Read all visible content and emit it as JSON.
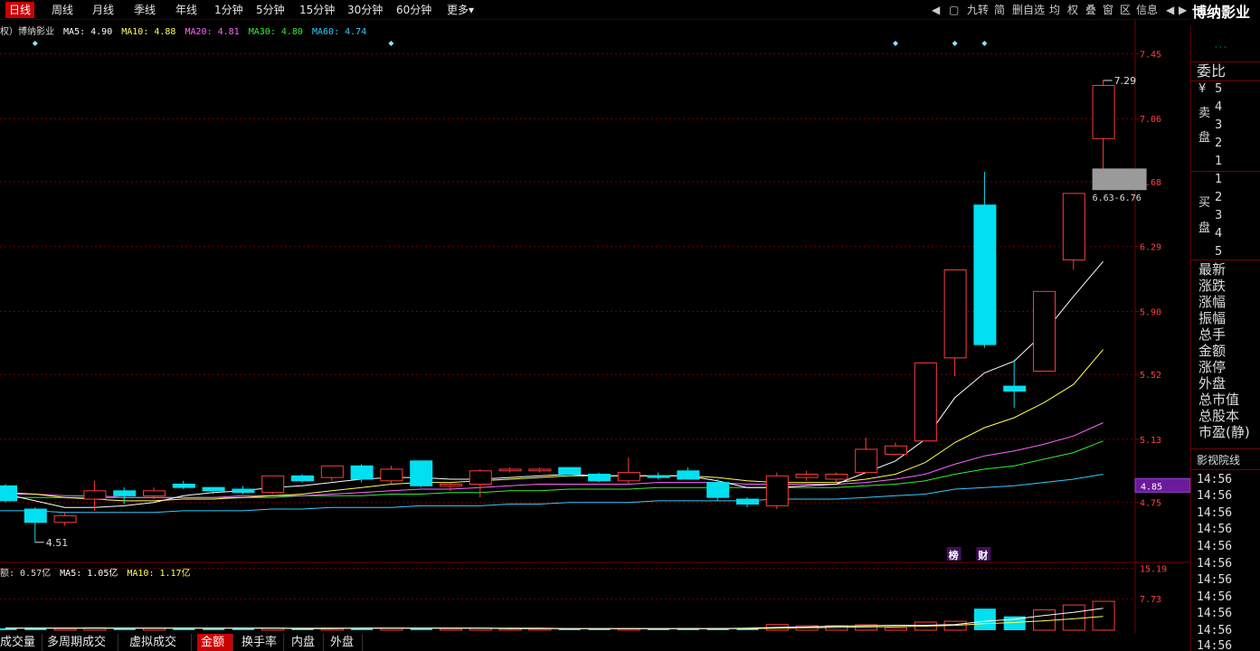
{
  "topbar": {
    "periods": [
      "日线",
      "周线",
      "月线",
      "季线",
      "年线",
      "1分钟",
      "5分钟",
      "15分钟",
      "30分钟",
      "60分钟",
      "更多"
    ],
    "active_index": 0,
    "more_arrow": "▾",
    "tools": [
      "▢",
      "九转",
      "简",
      "删自选",
      "均",
      "权",
      "叠",
      "窗",
      "区",
      "信息"
    ],
    "nav_left": "◀",
    "nav_right": "▶"
  },
  "header": {
    "stock_name": "博纳影业"
  },
  "legend": {
    "prefix": "权）博纳影业",
    "ma5": "MA5: 4.90",
    "ma10": "MA10: 4.88",
    "ma20": "MA20: 4.81",
    "ma30": "MA30: 4.80",
    "ma60": "MA60: 4.74"
  },
  "vol_legend": {
    "prefix": "额: 0.57亿",
    "ma5": "MA5: 1.05亿",
    "ma10": "MA10: 1.17亿"
  },
  "price_axis": {
    "ticks": [
      "7.45",
      "7.06",
      "6.68",
      "6.29",
      "5.90",
      "5.52",
      "5.13",
      "4.75"
    ],
    "current_label": "4.85",
    "hi_label": "7.29",
    "lo_label": "4.51",
    "range_label": "6.63-6.76",
    "markers": [
      "榜",
      "财"
    ]
  },
  "vol_axis": {
    "ticks": [
      "15.19",
      "7.73"
    ]
  },
  "side": {
    "wei_bi": "委比",
    "yen": "¥",
    "sell_label_1": "卖",
    "sell_label_2": "盘",
    "buy_label_1": "买",
    "buy_label_2": "盘",
    "sell_levels": [
      "5",
      "4",
      "3",
      "2",
      "1"
    ],
    "buy_levels": [
      "1",
      "2",
      "3",
      "4",
      "5"
    ],
    "stats": [
      "最新",
      "涨跌",
      "涨幅",
      "振幅",
      "总手",
      "金额",
      "涨停",
      "外盘",
      "总市值",
      "总股本",
      "市盈(静)"
    ],
    "sector": "影视院线",
    "times": [
      "14:56",
      "14:56",
      "14:56",
      "14:56",
      "14:56",
      "14:56",
      "14:56",
      "14:56",
      "14:56",
      "14:56",
      "14:56"
    ]
  },
  "bottom_tabs": [
    "成交量",
    "多周期成交量",
    "虚拟成交量",
    "金额",
    "换手率",
    "内盘",
    "外盘"
  ],
  "bottom_active_index": 3,
  "colors": {
    "up": "#ff3b3b",
    "down": "#00e0f0",
    "ma5": "#ffffff",
    "ma10": "#ffff55",
    "ma20": "#ff66ff",
    "ma30": "#33ee33",
    "ma60": "#33ccff",
    "grid": "#7a0000",
    "axis_text": "#ff4040"
  },
  "chart_data": {
    "type": "candlestick",
    "candles": [
      {
        "o": 4.85,
        "h": 4.86,
        "l": 4.75,
        "c": 4.76
      },
      {
        "o": 4.71,
        "h": 4.72,
        "l": 4.51,
        "c": 4.63
      },
      {
        "o": 4.63,
        "h": 4.69,
        "l": 4.61,
        "c": 4.67
      },
      {
        "o": 4.77,
        "h": 4.88,
        "l": 4.7,
        "c": 4.82
      },
      {
        "o": 4.82,
        "h": 4.84,
        "l": 4.74,
        "c": 4.79
      },
      {
        "o": 4.79,
        "h": 4.84,
        "l": 4.77,
        "c": 4.82
      },
      {
        "o": 4.86,
        "h": 4.88,
        "l": 4.83,
        "c": 4.84
      },
      {
        "o": 4.84,
        "h": 4.84,
        "l": 4.8,
        "c": 4.82
      },
      {
        "o": 4.83,
        "h": 4.85,
        "l": 4.8,
        "c": 4.81
      },
      {
        "o": 4.81,
        "h": 4.91,
        "l": 4.8,
        "c": 4.91
      },
      {
        "o": 4.91,
        "h": 4.92,
        "l": 4.87,
        "c": 4.88
      },
      {
        "o": 4.9,
        "h": 4.97,
        "l": 4.88,
        "c": 4.97
      },
      {
        "o": 4.97,
        "h": 4.98,
        "l": 4.87,
        "c": 4.89
      },
      {
        "o": 4.88,
        "h": 4.97,
        "l": 4.86,
        "c": 4.95
      },
      {
        "o": 5.0,
        "h": 5.0,
        "l": 4.84,
        "c": 4.85
      },
      {
        "o": 4.85,
        "h": 4.87,
        "l": 4.82,
        "c": 4.86
      },
      {
        "o": 4.86,
        "h": 4.95,
        "l": 4.78,
        "c": 4.94
      },
      {
        "o": 4.94,
        "h": 4.96,
        "l": 4.93,
        "c": 4.95
      },
      {
        "o": 4.94,
        "h": 4.96,
        "l": 4.93,
        "c": 4.95
      },
      {
        "o": 4.96,
        "h": 4.96,
        "l": 4.92,
        "c": 4.92
      },
      {
        "o": 4.92,
        "h": 4.93,
        "l": 4.87,
        "c": 4.88
      },
      {
        "o": 4.88,
        "h": 5.02,
        "l": 4.86,
        "c": 4.93
      },
      {
        "o": 4.91,
        "h": 4.93,
        "l": 4.89,
        "c": 4.9
      },
      {
        "o": 4.94,
        "h": 4.96,
        "l": 4.89,
        "c": 4.89
      },
      {
        "o": 4.87,
        "h": 4.89,
        "l": 4.76,
        "c": 4.78
      },
      {
        "o": 4.77,
        "h": 4.78,
        "l": 4.72,
        "c": 4.74
      },
      {
        "o": 4.73,
        "h": 4.93,
        "l": 4.71,
        "c": 4.91
      },
      {
        "o": 4.9,
        "h": 4.94,
        "l": 4.88,
        "c": 4.92
      },
      {
        "o": 4.89,
        "h": 4.93,
        "l": 4.87,
        "c": 4.92
      },
      {
        "o": 4.93,
        "h": 5.14,
        "l": 4.93,
        "c": 5.07
      },
      {
        "o": 5.04,
        "h": 5.11,
        "l": 5.04,
        "c": 5.09
      },
      {
        "o": 5.12,
        "h": 5.59,
        "l": 5.12,
        "c": 5.59
      },
      {
        "o": 5.62,
        "h": 6.15,
        "l": 5.51,
        "c": 6.15
      },
      {
        "o": 6.54,
        "h": 6.74,
        "l": 5.68,
        "c": 5.7
      },
      {
        "o": 5.45,
        "h": 5.61,
        "l": 5.32,
        "c": 5.42
      },
      {
        "o": 5.54,
        "h": 6.02,
        "l": 5.54,
        "c": 6.02
      },
      {
        "o": 6.21,
        "h": 6.61,
        "l": 6.15,
        "c": 6.61
      },
      {
        "o": 6.94,
        "h": 7.29,
        "l": 6.63,
        "c": 7.26
      }
    ],
    "ma5": [
      4.8,
      4.76,
      4.72,
      4.72,
      4.73,
      4.75,
      4.79,
      4.81,
      4.82,
      4.84,
      4.85,
      4.87,
      4.89,
      4.9,
      4.9,
      4.89,
      4.89,
      4.9,
      4.91,
      4.92,
      4.91,
      4.91,
      4.91,
      4.91,
      4.88,
      4.84,
      4.84,
      4.85,
      4.86,
      4.93,
      5.0,
      5.13,
      5.38,
      5.53,
      5.6,
      5.77,
      5.99,
      6.2
    ],
    "ma10": [
      4.81,
      4.8,
      4.78,
      4.77,
      4.76,
      4.76,
      4.77,
      4.77,
      4.78,
      4.79,
      4.8,
      4.82,
      4.84,
      4.86,
      4.87,
      4.87,
      4.88,
      4.89,
      4.9,
      4.91,
      4.91,
      4.91,
      4.91,
      4.91,
      4.9,
      4.88,
      4.87,
      4.87,
      4.87,
      4.89,
      4.92,
      4.99,
      5.11,
      5.2,
      5.26,
      5.35,
      5.46,
      5.67
    ],
    "ma20": [
      4.8,
      4.8,
      4.79,
      4.79,
      4.78,
      4.78,
      4.78,
      4.78,
      4.79,
      4.79,
      4.79,
      4.8,
      4.81,
      4.82,
      4.83,
      4.83,
      4.84,
      4.85,
      4.86,
      4.86,
      4.86,
      4.86,
      4.87,
      4.87,
      4.87,
      4.86,
      4.86,
      4.86,
      4.86,
      4.87,
      4.89,
      4.92,
      4.98,
      5.03,
      5.06,
      5.1,
      5.15,
      5.23
    ],
    "ma30": [
      4.78,
      4.78,
      4.78,
      4.78,
      4.78,
      4.78,
      4.78,
      4.78,
      4.78,
      4.78,
      4.79,
      4.79,
      4.79,
      4.8,
      4.8,
      4.81,
      4.81,
      4.82,
      4.82,
      4.83,
      4.83,
      4.83,
      4.84,
      4.84,
      4.84,
      4.84,
      4.84,
      4.84,
      4.84,
      4.85,
      4.86,
      4.88,
      4.92,
      4.95,
      4.97,
      5.01,
      5.05,
      5.12
    ],
    "ma60": [
      4.7,
      4.7,
      4.69,
      4.69,
      4.69,
      4.69,
      4.7,
      4.7,
      4.7,
      4.71,
      4.71,
      4.72,
      4.72,
      4.72,
      4.73,
      4.73,
      4.73,
      4.74,
      4.74,
      4.75,
      4.75,
      4.75,
      4.76,
      4.76,
      4.76,
      4.76,
      4.77,
      4.77,
      4.77,
      4.78,
      4.79,
      4.8,
      4.83,
      4.84,
      4.85,
      4.87,
      4.89,
      4.92
    ],
    "volume": [
      0.5,
      0.6,
      0.4,
      0.6,
      0.4,
      0.5,
      0.5,
      0.4,
      0.4,
      0.5,
      0.4,
      0.5,
      0.5,
      0.5,
      0.4,
      0.4,
      0.5,
      0.4,
      0.4,
      0.4,
      0.4,
      0.4,
      0.4,
      0.5,
      0.5,
      0.5,
      1.4,
      1.1,
      1.1,
      1.3,
      0.6,
      2.0,
      2.2,
      5.3,
      3.4,
      5.0,
      6.2,
      7.1
    ],
    "vol_ma5": [
      0.5,
      0.5,
      0.5,
      0.5,
      0.5,
      0.5,
      0.5,
      0.5,
      0.5,
      0.5,
      0.4,
      0.4,
      0.5,
      0.5,
      0.5,
      0.5,
      0.5,
      0.4,
      0.4,
      0.4,
      0.4,
      0.4,
      0.4,
      0.4,
      0.4,
      0.5,
      0.7,
      0.8,
      1.0,
      1.1,
      1.2,
      1.2,
      1.4,
      2.2,
      2.7,
      3.6,
      4.4,
      5.4
    ],
    "vol_ma10": [
      0.5,
      0.5,
      0.5,
      0.5,
      0.5,
      0.5,
      0.5,
      0.5,
      0.5,
      0.5,
      0.5,
      0.5,
      0.5,
      0.5,
      0.5,
      0.5,
      0.5,
      0.5,
      0.5,
      0.4,
      0.4,
      0.4,
      0.4,
      0.4,
      0.4,
      0.4,
      0.5,
      0.6,
      0.7,
      0.8,
      0.9,
      1.0,
      1.2,
      1.6,
      1.9,
      2.3,
      2.8,
      3.4
    ],
    "price_ylim": [
      4.4,
      7.6
    ],
    "vol_ylim": [
      0,
      16
    ],
    "diamond_markers_at": [
      1,
      13,
      30,
      32,
      33
    ]
  }
}
